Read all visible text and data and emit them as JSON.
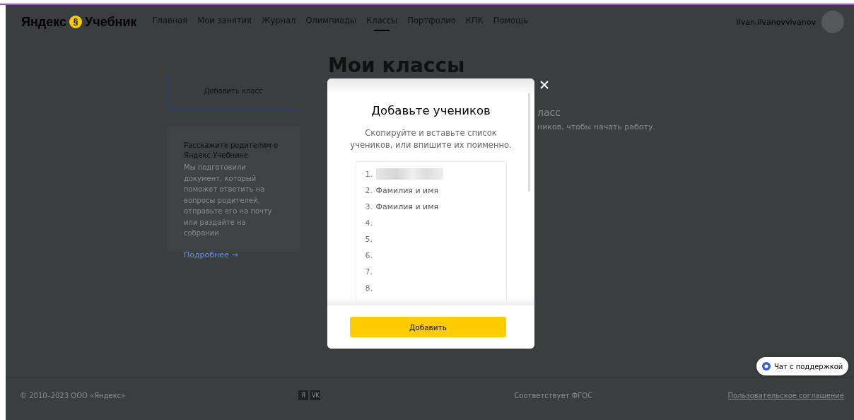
{
  "header": {
    "logo": {
      "left": "Яндекс",
      "badge": "§",
      "right": "Учебник"
    },
    "nav": [
      {
        "label": "Главная",
        "selected": false
      },
      {
        "label": "Мои занятия",
        "selected": false
      },
      {
        "label": "Журнал",
        "selected": false
      },
      {
        "label": "Олимпиады",
        "selected": false
      },
      {
        "label": "Классы",
        "selected": true
      },
      {
        "label": "Портфолио",
        "selected": false
      },
      {
        "label": "КПК",
        "selected": false
      },
      {
        "label": "Помощь",
        "selected": false
      }
    ],
    "user": "ilvan.ilvanovvivanov"
  },
  "sidebar": {
    "add_button": "Добавить класс",
    "info_card": {
      "title": "Расскажите родителям о Яндекс Учебнике",
      "text": "Мы подготовили документ, который поможет ответить на вопросы родителей, отправьте его на почту или раздайте на собрании.",
      "link": "Подробнее →"
    }
  },
  "main": {
    "heading": "Мои классы",
    "line_1": "ласс",
    "line_2": "ников, чтобы начать работу."
  },
  "modal": {
    "title": "Добавьте учеников",
    "subtitle": "Скопируйте и вставьте список учеников, или впишите их поименно.",
    "students": [
      {
        "number": "1.",
        "redacted": true
      },
      {
        "number": "2.",
        "placeholder": "Фамилия и имя",
        "redacted": false
      },
      {
        "number": "3.",
        "placeholder": "Фамилия и имя",
        "redacted": false
      },
      {
        "number": "4.",
        "redacted": false
      },
      {
        "number": "5.",
        "redacted": false
      },
      {
        "number": "6.",
        "redacted": false
      },
      {
        "number": "7.",
        "redacted": false
      },
      {
        "number": "8.",
        "redacted": false
      }
    ],
    "submit": "Добавить"
  },
  "chat_button": "Чат с поддержкой",
  "footer": {
    "copyright": "© 2010–2023 ООО «Яндекс»",
    "social": [
      "Я",
      "VK"
    ],
    "standard": "Соответствует ФГОС",
    "agreement": "Пользовательское соглашение"
  }
}
